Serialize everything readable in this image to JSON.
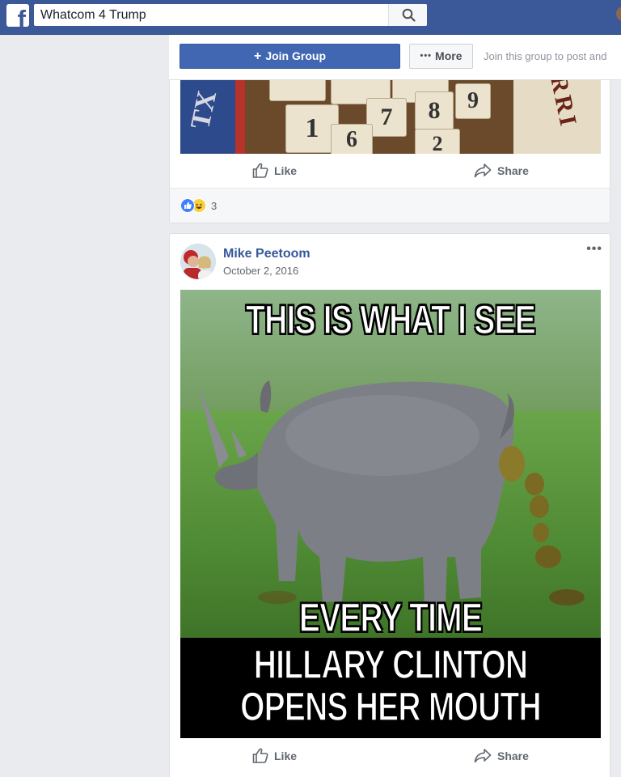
{
  "topbar": {
    "logo_icon": "facebook-f-icon",
    "search_value": "Whatcom 4 Trump",
    "search_icon": "search-icon",
    "brand_color": "#3b5998"
  },
  "group_header": {
    "join_label": "Join Group",
    "join_plus": "+",
    "more_label": "More",
    "more_dots": "•••",
    "join_hint": "Join this group to post and"
  },
  "post1": {
    "like_label": "Like",
    "share_label": "Share",
    "reactions": [
      "like",
      "haha"
    ],
    "reaction_count": "3"
  },
  "post2": {
    "author": "Mike Peetoom",
    "date": "October 2, 2016",
    "menu_dots": "•••",
    "meme": {
      "top_text": "THIS IS WHAT I SEE",
      "middle_text": "EVERY TIME",
      "bottom_line1": "HILLARY CLINTON",
      "bottom_line2": "OPENS HER MOUTH"
    },
    "like_label": "Like",
    "share_label": "Share"
  },
  "image1": {
    "block_numbers": [
      "1",
      "7",
      "8",
      "9",
      "6",
      "2"
    ],
    "left_letters": "TX",
    "right_letters": "RRI"
  }
}
